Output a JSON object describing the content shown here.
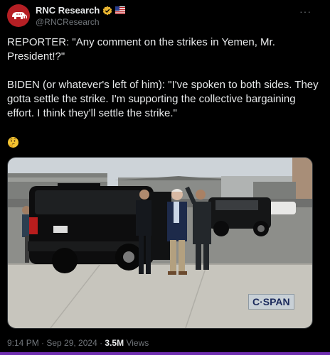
{
  "author": {
    "display_name": "RNC Research",
    "handle": "@RNCResearch",
    "verified": true
  },
  "post": {
    "paragraph_1": "REPORTER: \"Any comment on the strikes in Yemen, Mr. President!?\"",
    "paragraph_2": "BIDEN (or whatever's left of him): \"I've spoken to both sides. They gotta settle the strike. I'm supporting the collective bargaining effort. I think they'll settle the strike.\"",
    "emoji": "thinking-face",
    "media_watermark": "C·SPAN",
    "timestamp": "9:14 PM · Sep 29, 2024 · ",
    "views_count": "3.5M",
    "views_label": " Views"
  },
  "colors": {
    "background": "#000000",
    "text": "#e7e9ea",
    "secondary_text": "#71767b",
    "verified_badge": "#e9b531",
    "bottom_accent": "#6f2fb0"
  }
}
